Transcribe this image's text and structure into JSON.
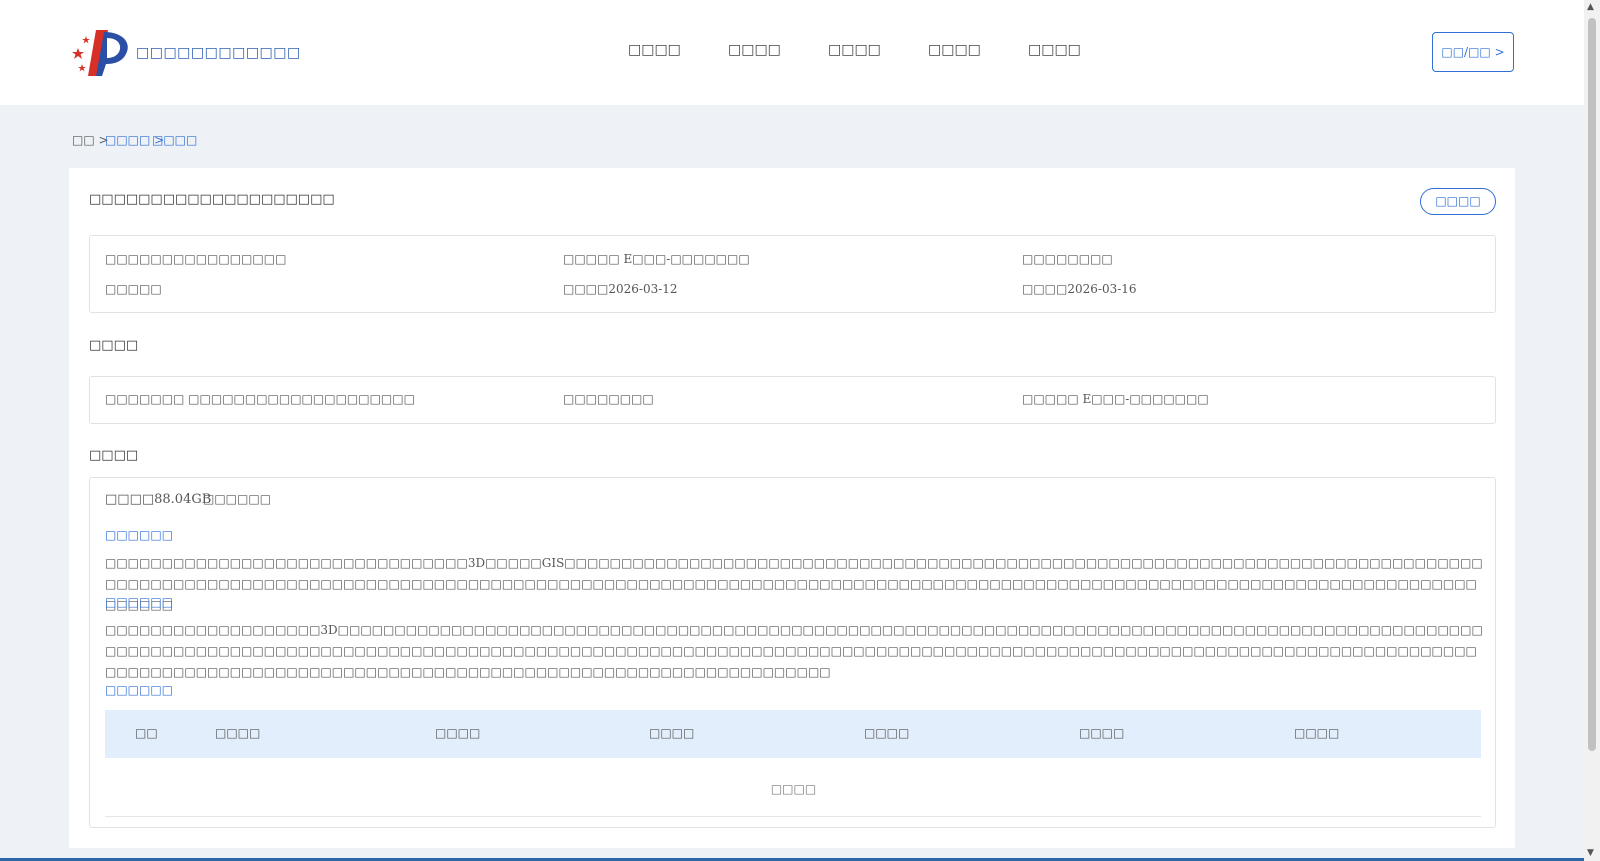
{
  "header": {
    "brand": "□□□□□□□□□□□□",
    "nav": [
      "□□□□",
      "□□□□",
      "□□□□",
      "□□□□",
      "□□□□"
    ],
    "login_label": "□□/□□ >"
  },
  "breadcrumb": {
    "home": "□□ >",
    "parent": "□□□□ >",
    "current": "□□□□"
  },
  "card": {
    "title": "□□□□□□□□□□□□□□□□□□□□",
    "fav_label": "□□□□",
    "meta_rows": [
      [
        "□□□□□□□□□□□□□□□□",
        "□□□□□ E□□□-□□□□□□□",
        "□□□□□□□□"
      ],
      [
        "□□□□□",
        "□□□□2026-03-12",
        "□□□□2026-03-16"
      ]
    ],
    "section2_title": "□□□□",
    "section2_cells": [
      "□□□□□□□ □□□□□□□□□□□□□□□□□□□□",
      "□□□□□□□□",
      "□□□□□ E□□□-□□□□□□□"
    ],
    "section3_title": "□□□□",
    "size_text": "□□□□88.04GB",
    "format_text": "□□□□□□",
    "sub1_title": "□□□□□□",
    "para1": "□□□□□□□□□□□□□□□□□□□□□□□□□□□□□□□□3D□□□□□GIS□□□□□□□□□□□□□□□□□□□□□□□□□□□□□□□□□□□□□□□□□□□□□□□□□□□□□□□□□□□□□□□□□□□□□□□□□□□□□□□□□□□□□□□□□□□□□□□□□□□□□□□□□□□□□□□□□□□□□□□□□□□□□□□□□□□□□□□□□□□□□□□□□□□□□□□□□□□□□□□□□□□□□□□□□□□□□□□□□□□□□□□□□□□□□□□□□□□□□□□□□□□□□□□□",
    "sub2_title": "□□□□□□",
    "para2": "□□□□□□□□□□□□□□□□□□□3D□□□□□□□□□□□□□□□□□□□□□□□□□□□□□□□□□□□□□□□□□□□□□□□□□□□□□□□□□□□□□□□□□□□□□□□□□□□□□□□□□□□□□□□□□□□□□□□□□□□□□□□□□□□□□□□□□□□□□□□□□□□□□□□□□□□□□□□□□□□□□□□□□□□□□□□□□□□□□□□□□□□□□□□□□□□□□□□□□□□□□□□□□□□□□□□□□□□□□□□□□□□□□□□□□□□□□□□□□□□□□□□□□□□□□□□□□□□□□□□□□□□□□□□□□□□□□□□□□□□□□□□□□□□□□□□□□□□□□□□□□□□□□□",
    "sub3_title": "□□□□□□",
    "table_headers": [
      "□□",
      "□□□□",
      "□□□□",
      "□□□□",
      "□□□□",
      "□□□□",
      "□□□□"
    ],
    "empty_text": "□□□□"
  },
  "colors": {
    "accent": "#2f6fd6",
    "table_head_bg": "#e3eefc",
    "page_bg": "#eef2f6",
    "bottom_bar": "#2a66a8"
  }
}
